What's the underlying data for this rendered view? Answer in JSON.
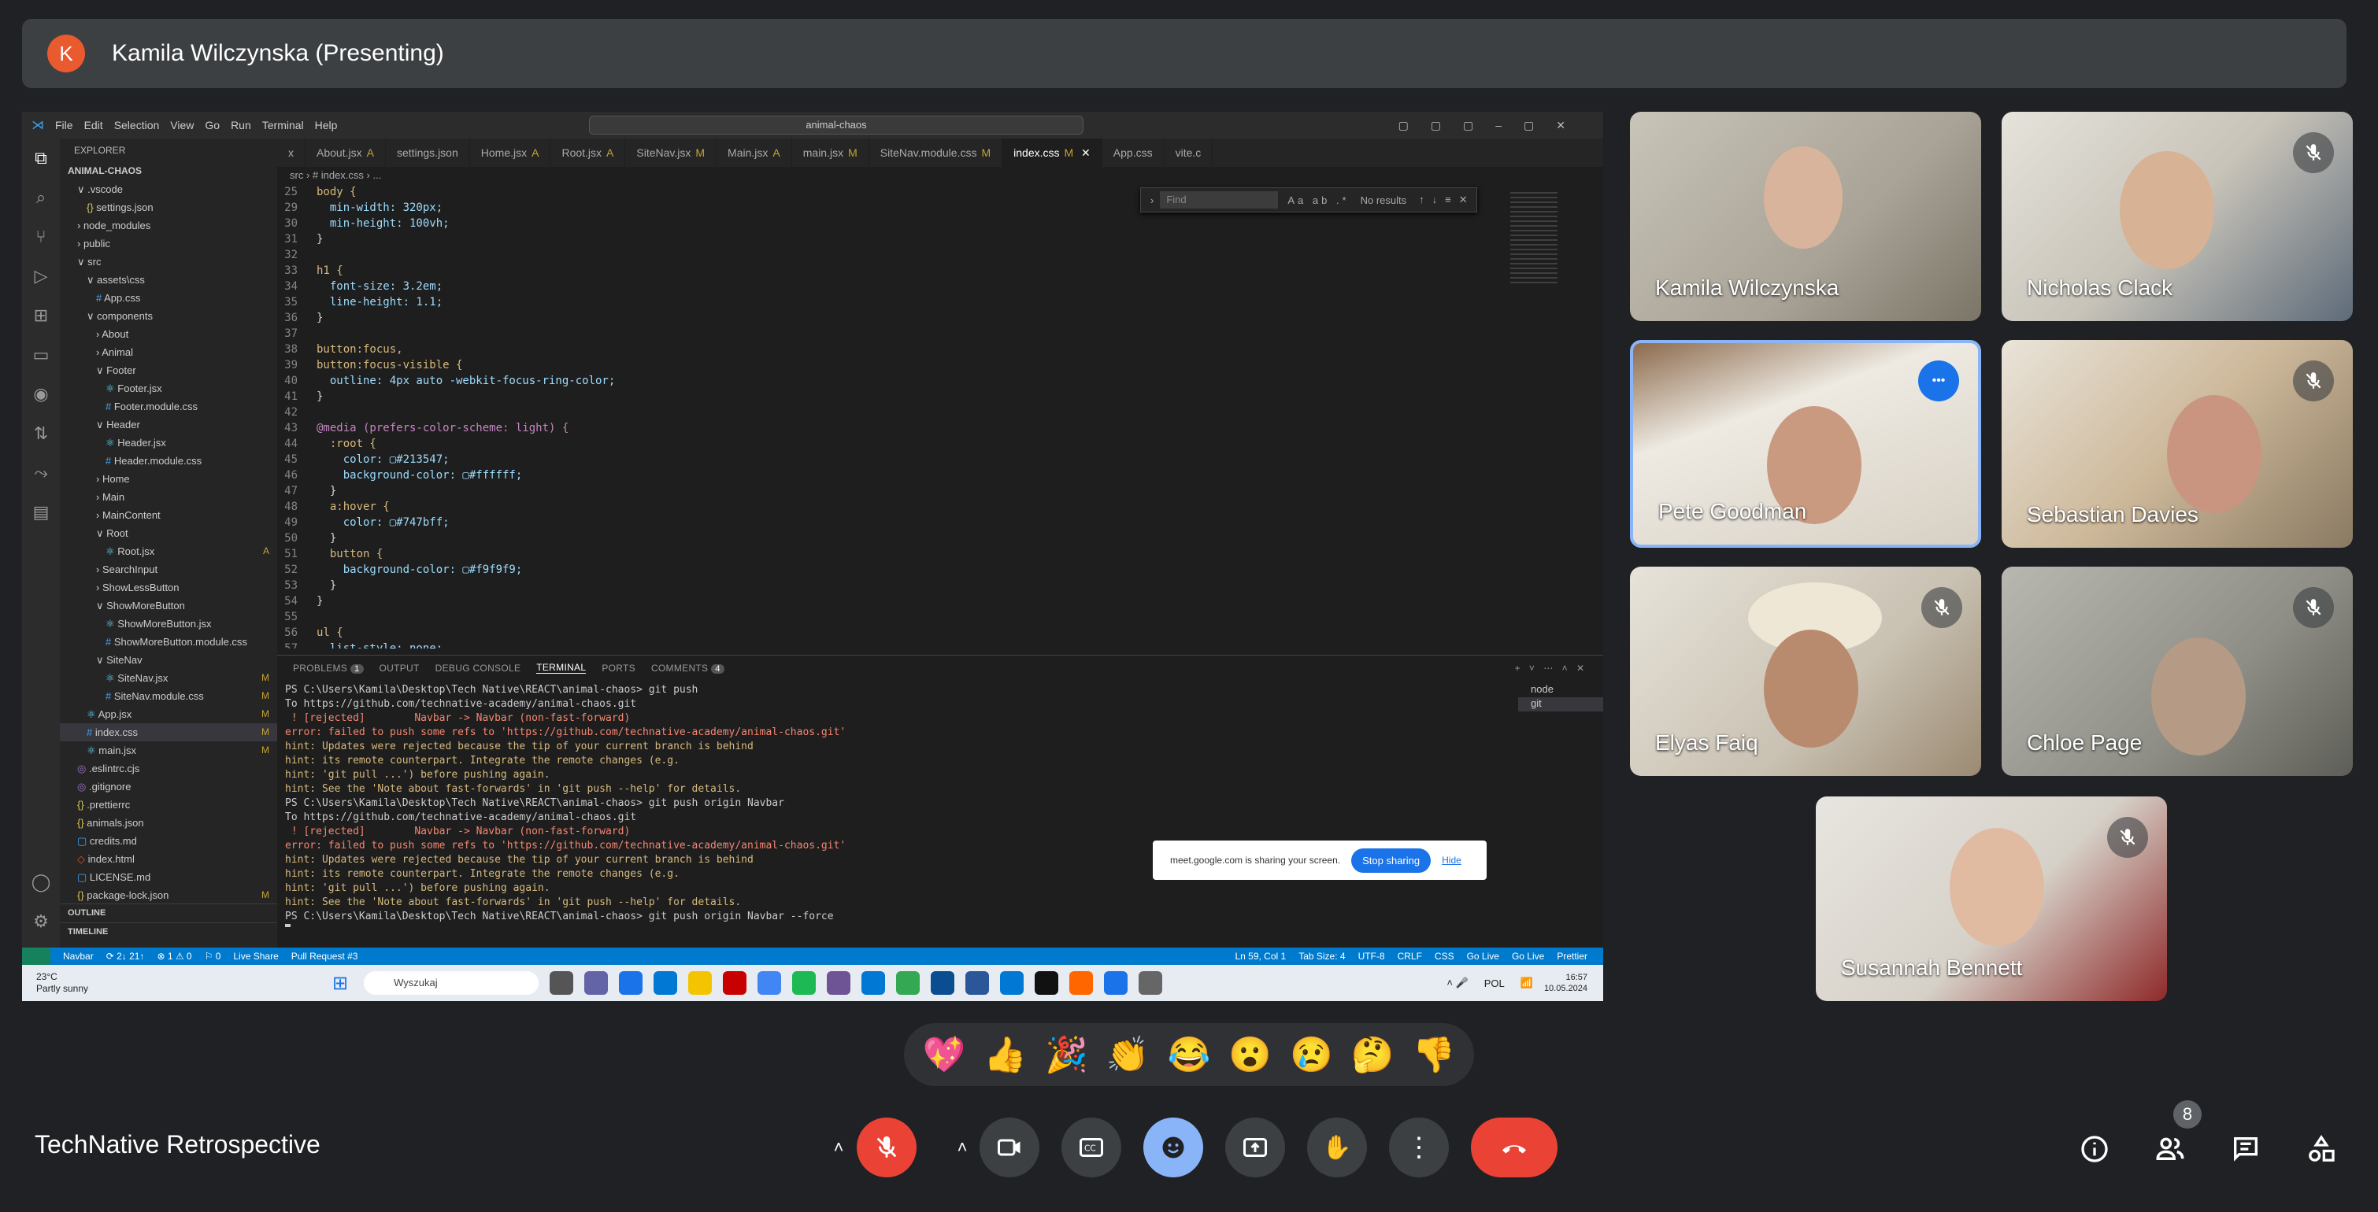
{
  "meet": {
    "presenter_initial": "K",
    "presenter_label": "Kamila Wilczynska (Presenting)",
    "meeting_title": "TechNative Retrospective",
    "people_count": "8",
    "participants": [
      "Kamila Wilczynska",
      "Nicholas Clack",
      "Pete Goodman",
      "Sebastian Davies",
      "Elyas Faiq",
      "Chloe Page",
      "Susannah Bennett"
    ],
    "reactions": [
      "💖",
      "👍",
      "🎉",
      "👏",
      "😂",
      "😮",
      "😢",
      "🤔",
      "👎"
    ],
    "share_notice": "meet.google.com is sharing your screen.",
    "stop_sharing": "Stop sharing",
    "hide": "Hide",
    "more": "•••"
  },
  "vscode": {
    "menu": [
      "File",
      "Edit",
      "Selection",
      "View",
      "Go",
      "Run",
      "Terminal",
      "Help"
    ],
    "search": "animal-chaos",
    "explorer": "EXPLORER",
    "root": "ANIMAL-CHAOS",
    "tree": [
      {
        "l": ".vscode",
        "d": 1,
        "t": "dir"
      },
      {
        "l": "settings.json",
        "d": 2,
        "t": "json"
      },
      {
        "l": "node_modules",
        "d": 1,
        "t": "dirc"
      },
      {
        "l": "public",
        "d": 1,
        "t": "dirc"
      },
      {
        "l": "src",
        "d": 1,
        "t": "dir"
      },
      {
        "l": "assets\\css",
        "d": 2,
        "t": "dir"
      },
      {
        "l": "App.css",
        "d": 3,
        "t": "css"
      },
      {
        "l": "components",
        "d": 2,
        "t": "dir"
      },
      {
        "l": "About",
        "d": 3,
        "t": "dirc"
      },
      {
        "l": "Animal",
        "d": 3,
        "t": "dirc"
      },
      {
        "l": "Footer",
        "d": 3,
        "t": "dir"
      },
      {
        "l": "Footer.jsx",
        "d": 4,
        "t": "jsx"
      },
      {
        "l": "Footer.module.css",
        "d": 4,
        "t": "css"
      },
      {
        "l": "Header",
        "d": 3,
        "t": "dir"
      },
      {
        "l": "Header.jsx",
        "d": 4,
        "t": "jsx"
      },
      {
        "l": "Header.module.css",
        "d": 4,
        "t": "css"
      },
      {
        "l": "Home",
        "d": 3,
        "t": "dirc"
      },
      {
        "l": "Main",
        "d": 3,
        "t": "dirc"
      },
      {
        "l": "MainContent",
        "d": 3,
        "t": "dirc"
      },
      {
        "l": "Root",
        "d": 3,
        "t": "dir"
      },
      {
        "l": "Root.jsx",
        "d": 4,
        "t": "jsx",
        "b": "A"
      },
      {
        "l": "SearchInput",
        "d": 3,
        "t": "dirc"
      },
      {
        "l": "ShowLessButton",
        "d": 3,
        "t": "dirc"
      },
      {
        "l": "ShowMoreButton",
        "d": 3,
        "t": "dir"
      },
      {
        "l": "ShowMoreButton.jsx",
        "d": 4,
        "t": "jsx"
      },
      {
        "l": "ShowMoreButton.module.css",
        "d": 4,
        "t": "css"
      },
      {
        "l": "SiteNav",
        "d": 3,
        "t": "dir"
      },
      {
        "l": "SiteNav.jsx",
        "d": 4,
        "t": "jsx",
        "b": "M"
      },
      {
        "l": "SiteNav.module.css",
        "d": 4,
        "t": "css",
        "b": "M"
      },
      {
        "l": "App.jsx",
        "d": 2,
        "t": "jsx",
        "b": "M"
      },
      {
        "l": "index.css",
        "d": 2,
        "t": "css",
        "b": "M",
        "s": 1
      },
      {
        "l": "main.jsx",
        "d": 2,
        "t": "jsx",
        "b": "M"
      },
      {
        "l": ".eslintrc.cjs",
        "d": 1,
        "t": "cfg"
      },
      {
        "l": ".gitignore",
        "d": 1,
        "t": "cfg"
      },
      {
        "l": ".prettierrc",
        "d": 1,
        "t": "json"
      },
      {
        "l": "animals.json",
        "d": 1,
        "t": "json"
      },
      {
        "l": "credits.md",
        "d": 1,
        "t": "md"
      },
      {
        "l": "index.html",
        "d": 1,
        "t": "html"
      },
      {
        "l": "LICENSE.md",
        "d": 1,
        "t": "md"
      },
      {
        "l": "package-lock.json",
        "d": 1,
        "t": "json",
        "b": "M"
      }
    ],
    "outline": "OUTLINE",
    "timeline": "TIMELINE",
    "tabs": [
      {
        "l": "x"
      },
      {
        "l": "About.jsx",
        "b": "A"
      },
      {
        "l": "settings.json"
      },
      {
        "l": "Home.jsx",
        "b": "A"
      },
      {
        "l": "Root.jsx",
        "b": "A"
      },
      {
        "l": "SiteNav.jsx",
        "b": "M"
      },
      {
        "l": "Main.jsx",
        "b": "A"
      },
      {
        "l": "main.jsx",
        "b": "M"
      },
      {
        "l": "SiteNav.module.css",
        "b": "M"
      },
      {
        "l": "index.css",
        "b": "M",
        "a": 1
      },
      {
        "l": "App.css"
      },
      {
        "l": "vite.c"
      }
    ],
    "breadcrumb": "src  ›  # index.css  › ...",
    "find_placeholder": "Find",
    "find_result": "No results",
    "code": [
      {
        "n": "25",
        "c": "body {",
        "k": "sel"
      },
      {
        "n": "29",
        "c": "  min-width: 320px;",
        "k": "pv"
      },
      {
        "n": "30",
        "c": "  min-height: 100vh;",
        "k": "pv"
      },
      {
        "n": "31",
        "c": "}",
        "k": ""
      },
      {
        "n": "32",
        "c": "",
        "k": ""
      },
      {
        "n": "33",
        "c": "h1 {",
        "k": "sel"
      },
      {
        "n": "34",
        "c": "  font-size: 3.2em;",
        "k": "pv"
      },
      {
        "n": "35",
        "c": "  line-height: 1.1;",
        "k": "pv"
      },
      {
        "n": "36",
        "c": "}",
        "k": ""
      },
      {
        "n": "37",
        "c": "",
        "k": ""
      },
      {
        "n": "38",
        "c": "button:focus,",
        "k": "sel"
      },
      {
        "n": "39",
        "c": "button:focus-visible {",
        "k": "sel"
      },
      {
        "n": "40",
        "c": "  outline: 4px auto -webkit-focus-ring-color;",
        "k": "pv"
      },
      {
        "n": "41",
        "c": "}",
        "k": ""
      },
      {
        "n": "42",
        "c": "",
        "k": ""
      },
      {
        "n": "43",
        "c": "@media (prefers-color-scheme: light) {",
        "k": "at"
      },
      {
        "n": "44",
        "c": "  :root {",
        "k": "sel"
      },
      {
        "n": "45",
        "c": "    color: ▢#213547;",
        "k": "pv"
      },
      {
        "n": "46",
        "c": "    background-color: ▢#ffffff;",
        "k": "pv"
      },
      {
        "n": "47",
        "c": "  }",
        "k": ""
      },
      {
        "n": "48",
        "c": "  a:hover {",
        "k": "sel"
      },
      {
        "n": "49",
        "c": "    color: ▢#747bff;",
        "k": "pv"
      },
      {
        "n": "50",
        "c": "  }",
        "k": ""
      },
      {
        "n": "51",
        "c": "  button {",
        "k": "sel"
      },
      {
        "n": "52",
        "c": "    background-color: ▢#f9f9f9;",
        "k": "pv"
      },
      {
        "n": "53",
        "c": "  }",
        "k": ""
      },
      {
        "n": "54",
        "c": "}",
        "k": ""
      },
      {
        "n": "55",
        "c": "",
        "k": ""
      },
      {
        "n": "56",
        "c": "ul {",
        "k": "sel"
      },
      {
        "n": "57",
        "c": "  list-style: none;",
        "k": "pv"
      }
    ],
    "panel_tabs": [
      {
        "l": "PROBLEMS",
        "c": "1"
      },
      {
        "l": "OUTPUT"
      },
      {
        "l": "DEBUG CONSOLE"
      },
      {
        "l": "TERMINAL",
        "a": 1
      },
      {
        "l": "PORTS"
      },
      {
        "l": "COMMENTS",
        "c": "4"
      }
    ],
    "terminal": [
      {
        "t": "PS C:\\Users\\Kamila\\Desktop\\Tech Native\\REACT\\animal-chaos> git push",
        "k": "plain"
      },
      {
        "t": "To https://github.com/technative-academy/animal-chaos.git",
        "k": "plain"
      },
      {
        "t": " ! [rejected]        Navbar -> Navbar (non-fast-forward)",
        "k": "rej"
      },
      {
        "t": "error: failed to push some refs to 'https://github.com/technative-academy/animal-chaos.git'",
        "k": "err"
      },
      {
        "t": "hint: Updates were rejected because the tip of your current branch is behind",
        "k": "hint"
      },
      {
        "t": "hint: its remote counterpart. Integrate the remote changes (e.g.",
        "k": "hint"
      },
      {
        "t": "hint: 'git pull ...') before pushing again.",
        "k": "hint"
      },
      {
        "t": "hint: See the 'Note about fast-forwards' in 'git push --help' for details.",
        "k": "hint"
      },
      {
        "t": "PS C:\\Users\\Kamila\\Desktop\\Tech Native\\REACT\\animal-chaos> git push origin Navbar",
        "k": "plain"
      },
      {
        "t": "To https://github.com/technative-academy/animal-chaos.git",
        "k": "plain"
      },
      {
        "t": " ! [rejected]        Navbar -> Navbar (non-fast-forward)",
        "k": "rej"
      },
      {
        "t": "error: failed to push some refs to 'https://github.com/technative-academy/animal-chaos.git'",
        "k": "err"
      },
      {
        "t": "hint: Updates were rejected because the tip of your current branch is behind",
        "k": "hint"
      },
      {
        "t": "hint: its remote counterpart. Integrate the remote changes (e.g.",
        "k": "hint"
      },
      {
        "t": "hint: 'git pull ...') before pushing again.",
        "k": "hint"
      },
      {
        "t": "hint: See the 'Note about fast-forwards' in 'git push --help' for details.",
        "k": "hint"
      },
      {
        "t": "PS C:\\Users\\Kamila\\Desktop\\Tech Native\\REACT\\animal-chaos> git push origin Navbar --force",
        "k": "plain"
      }
    ],
    "terminals": [
      "node",
      "git"
    ],
    "status_left": [
      "Navbar",
      "⟳ 2↓ 21↑",
      "⊗ 1 ⚠ 0",
      "⚐ 0",
      "Live Share",
      "Pull Request #3"
    ],
    "status_right": [
      "Ln 59, Col 1",
      "Tab Size: 4",
      "UTF-8",
      "CRLF",
      "CSS",
      "Go Live",
      "Go Live",
      "Prettier"
    ]
  },
  "taskbar": {
    "temp": "23°C",
    "weather": "Partly sunny",
    "search": "Wyszukaj",
    "lang": "POL",
    "time": "16:57",
    "date": "10.05.2024"
  }
}
